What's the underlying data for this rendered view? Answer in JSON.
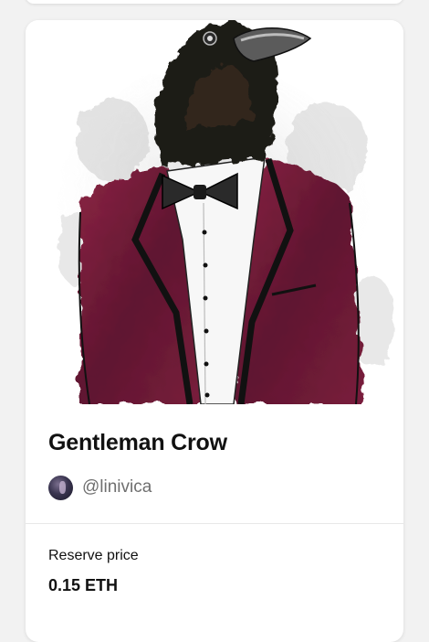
{
  "nft": {
    "title": "Gentleman Crow",
    "creator_handle": "@linivica",
    "reserve_label": "Reserve price",
    "reserve_value": "0.15 ETH"
  },
  "icons": {
    "avatar": "creator-avatar"
  },
  "colors": {
    "jacket": "#6e1a34",
    "page_bg": "#f2f2f2",
    "card_bg": "#ffffff",
    "muted_text": "#6f6f6f"
  }
}
